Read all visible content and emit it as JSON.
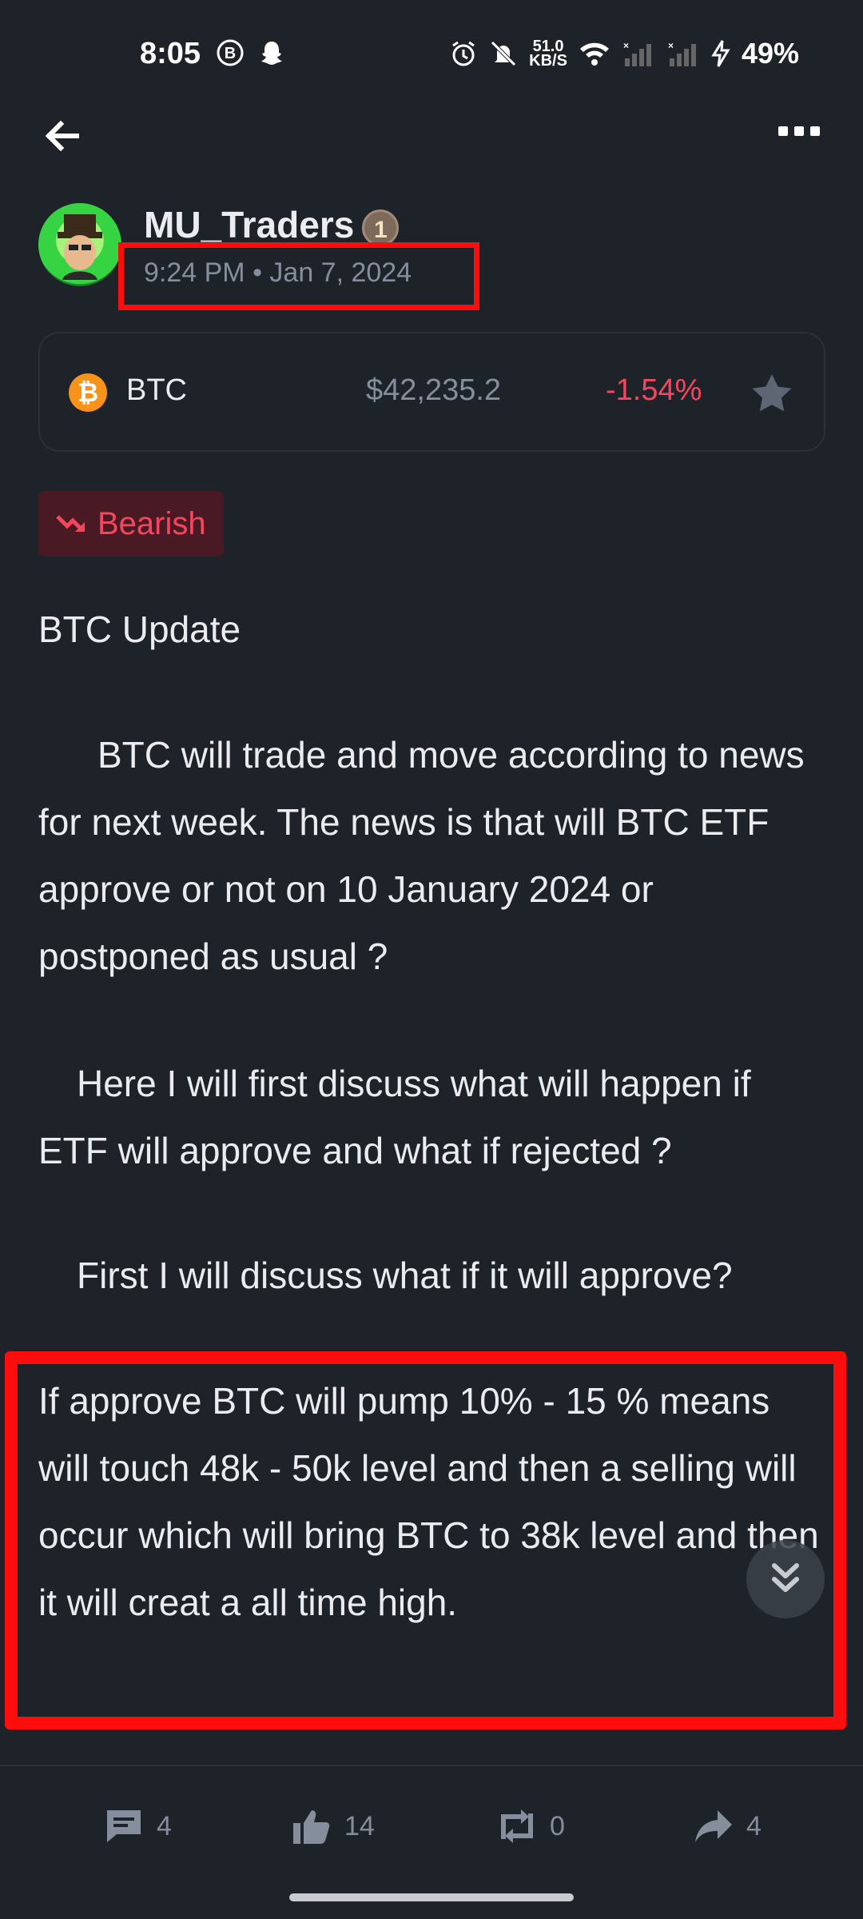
{
  "status_bar": {
    "time": "8:05",
    "net_speed_value": "51.0",
    "net_speed_unit": "KB/S",
    "battery": "49%"
  },
  "author": {
    "name": "MU_Traders",
    "rank": "1",
    "datetime": "9:24 PM • Jan 7, 2024"
  },
  "coin": {
    "symbol": "BTC",
    "icon_letter": "₿",
    "price": "$42,235.2",
    "change": "-1.54%",
    "change_color": "#f6465d"
  },
  "sentiment": {
    "label": "Bearish",
    "color": "#f6465d"
  },
  "post": {
    "title": "BTC Update",
    "paragraphs": [
      "BTC will trade and move according to news for next week. The news is that will BTC ETF approve or not on 10 January 2024 or postponed as usual ?",
      "Here I will first discuss what will happen if ETF will approve and what if rejected ?",
      "First I will discuss what if it will approve?",
      "If approve BTC will pump 10% - 15 % means will touch 48k - 50k level and then a selling will occur which will bring BTC to 38k level and then it will creat a all time high."
    ]
  },
  "actions": {
    "comments": "4",
    "likes": "14",
    "reposts": "0",
    "shares": "4"
  },
  "icons": {
    "back": "arrow-left-icon",
    "more": "more-horizontal-icon",
    "star": "star-icon",
    "trend": "trend-down-icon",
    "scroll": "double-chevron-down-icon",
    "comment": "comment-icon",
    "like": "thumbs-up-icon",
    "repost": "repost-icon",
    "share": "share-icon"
  },
  "colors": {
    "background": "#1e2329",
    "text": "#eaecef",
    "muted": "#848e9c",
    "highlight_box": "#ff0d0d"
  }
}
